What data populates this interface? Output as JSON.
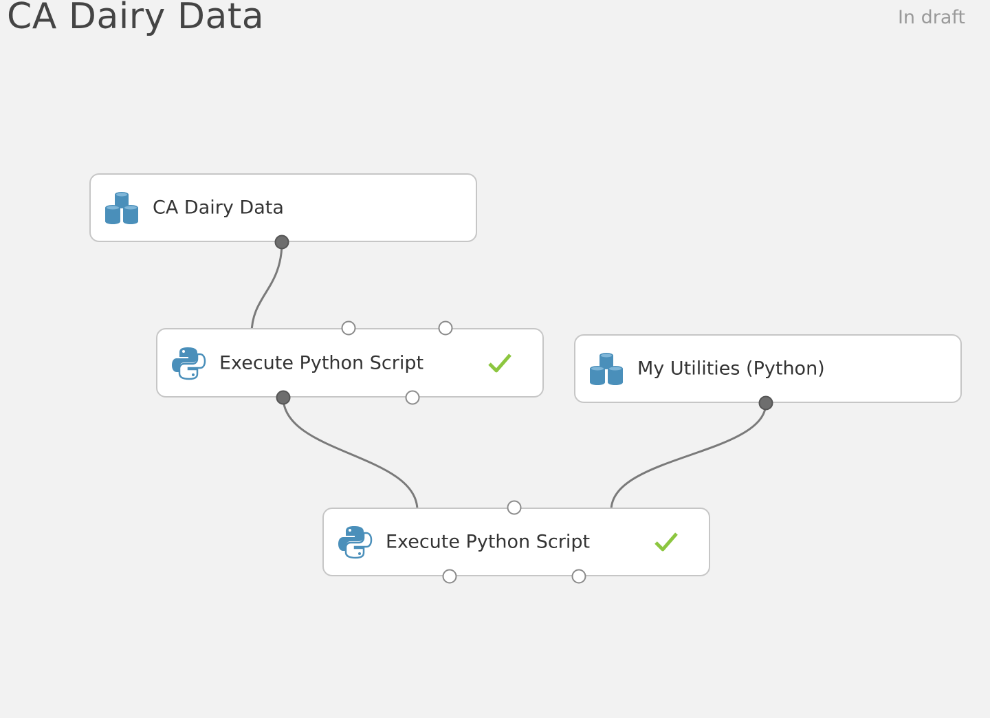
{
  "experiment": {
    "title": "CA Dairy Data",
    "status": "In draft"
  },
  "modules": [
    {
      "label": "CA Dairy Data",
      "icon": "dataset-icon",
      "type": "dataset"
    },
    {
      "label": "Execute Python Script",
      "icon": "python-icon",
      "type": "script",
      "completed": true
    },
    {
      "label": "My Utilities (Python)",
      "icon": "dataset-icon",
      "type": "dataset"
    },
    {
      "label": "Execute Python Script",
      "icon": "python-icon",
      "type": "script",
      "completed": true
    }
  ],
  "colors": {
    "canvas": "#f2f2f2",
    "module_border": "#c6c6c6",
    "connector": "#7a7a7a",
    "icon_blue": "#4a8fba",
    "python_yellow": "#f2c84b",
    "success_check": "#8cc63f"
  }
}
